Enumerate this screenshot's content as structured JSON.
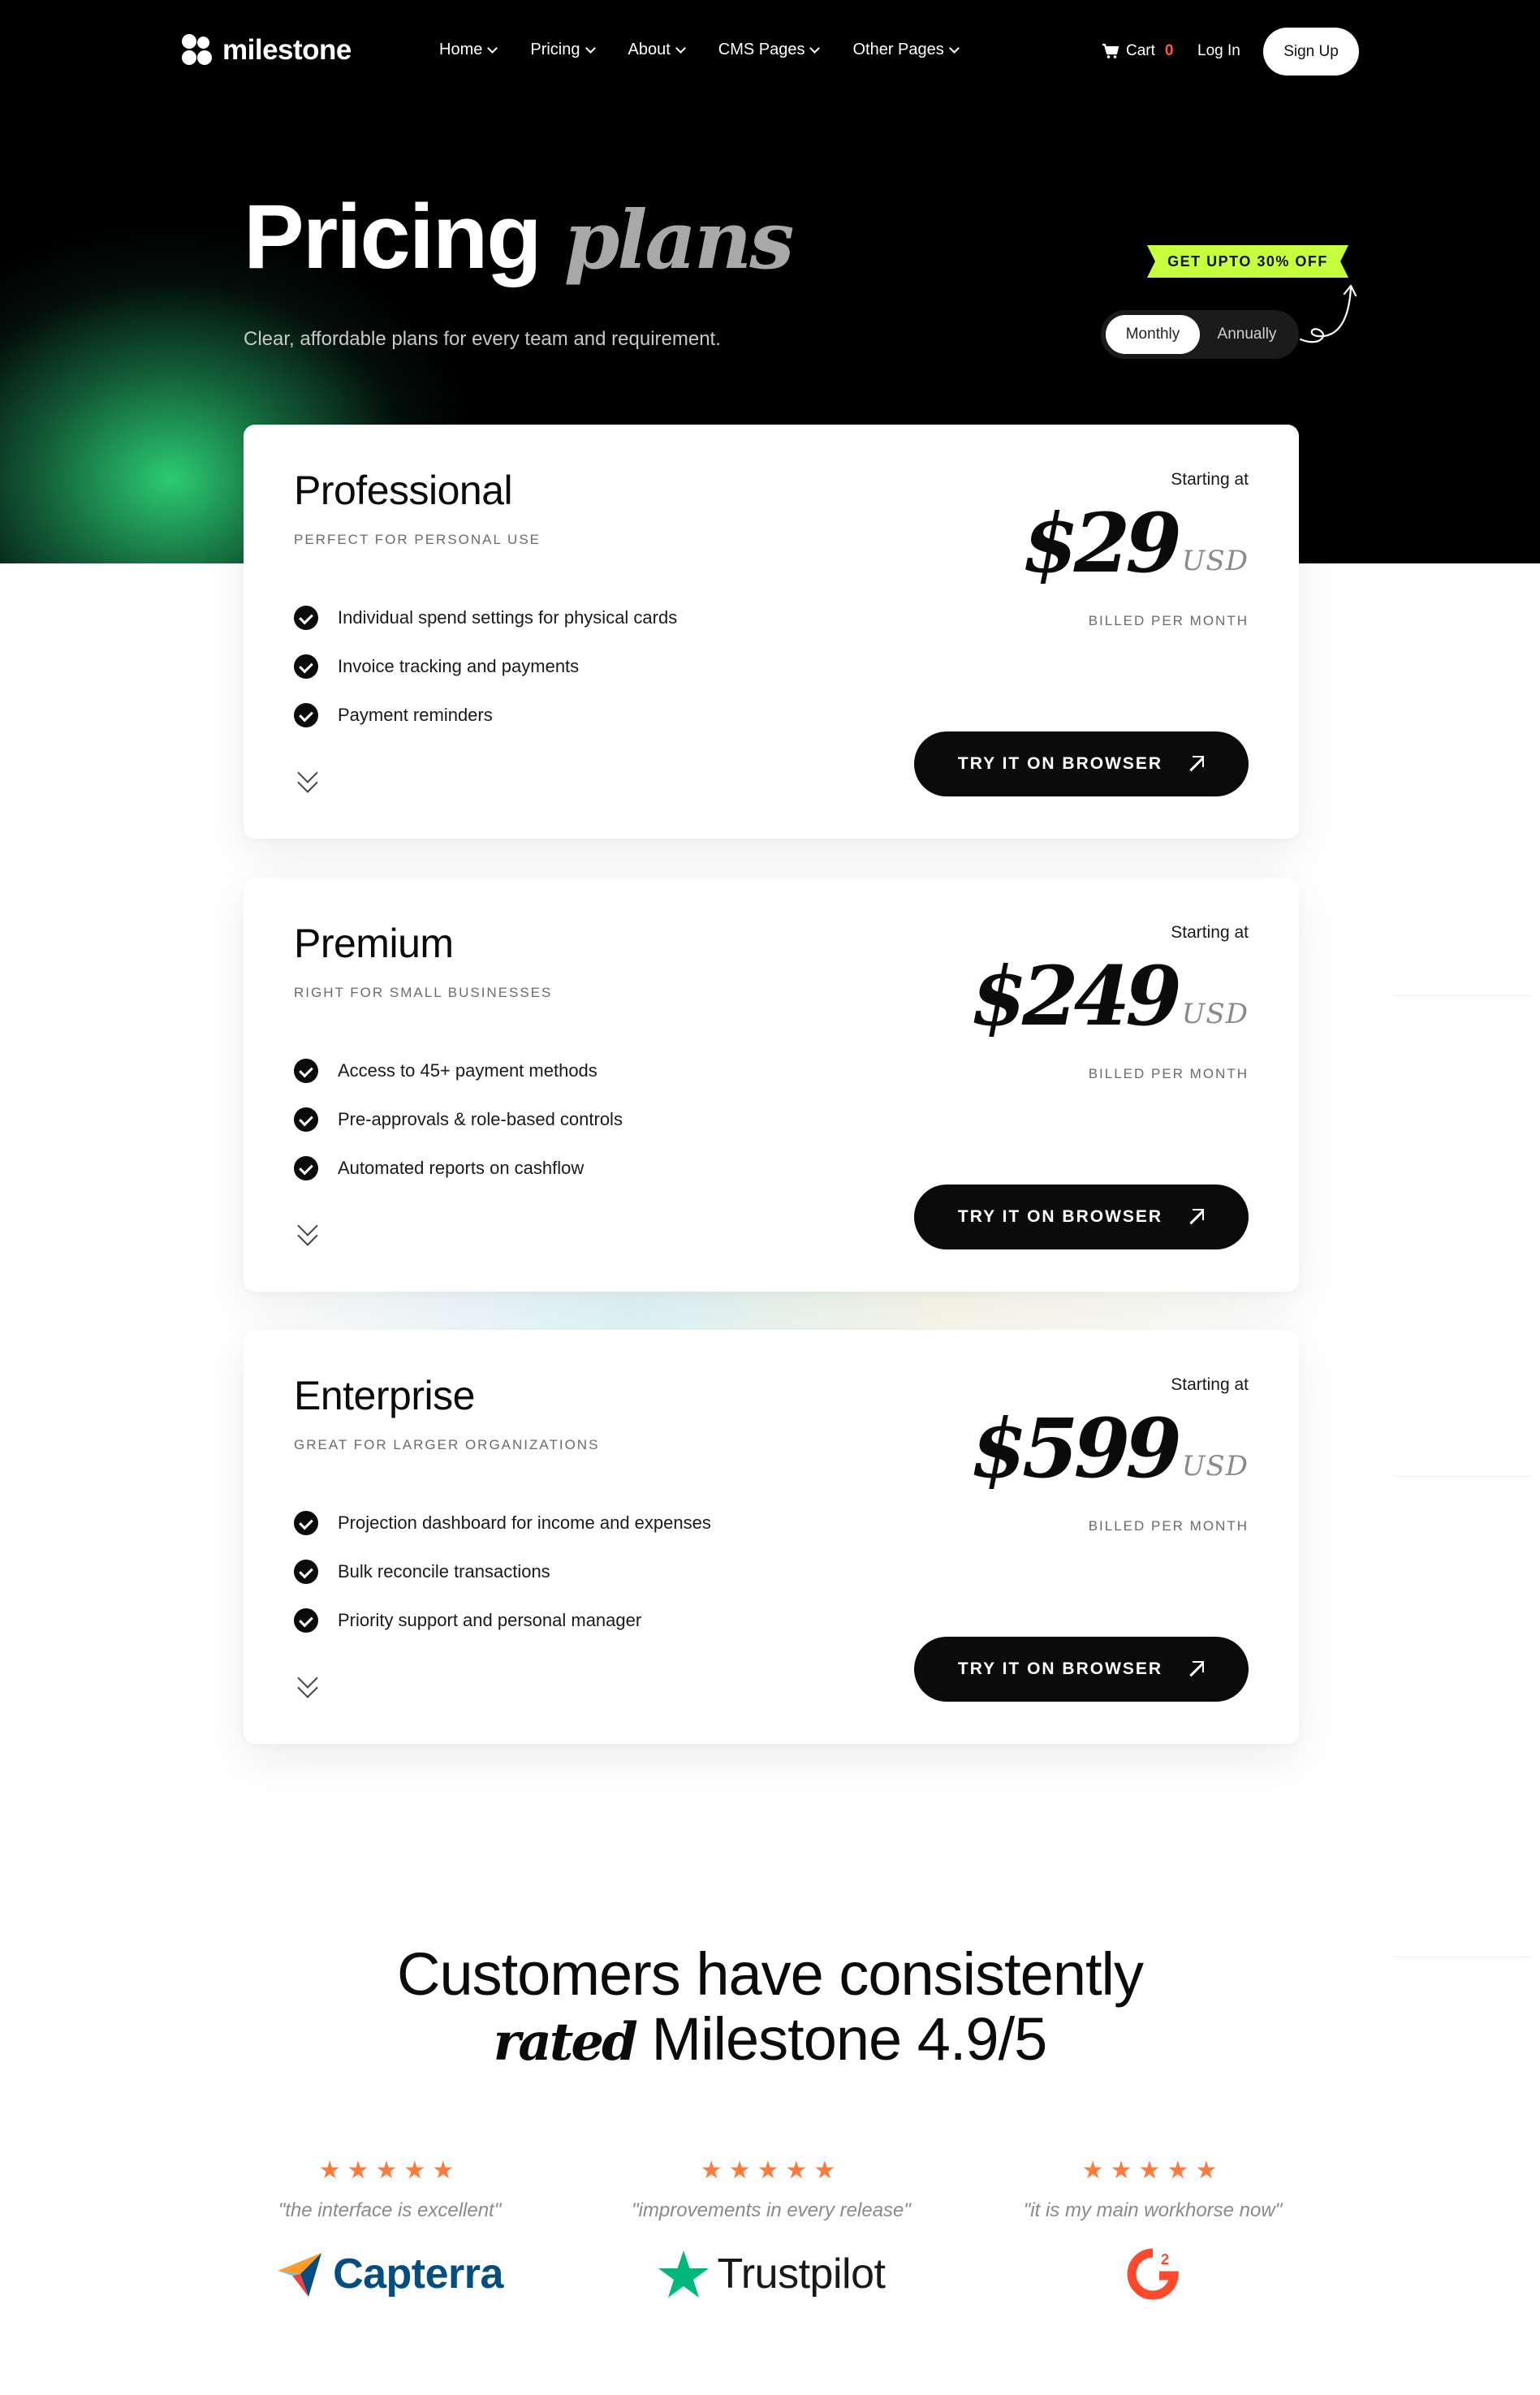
{
  "nav": {
    "brand": "milestone",
    "menu": [
      {
        "label": "Home"
      },
      {
        "label": "Pricing"
      },
      {
        "label": "About"
      },
      {
        "label": "CMS Pages"
      },
      {
        "label": "Other Pages"
      }
    ],
    "cart_label": "Cart",
    "cart_count": "0",
    "login": "Log In",
    "signup": "Sign Up"
  },
  "hero": {
    "title_main": "Pricing",
    "title_italic": "plans",
    "subtitle": "Clear, affordable plans for every team and requirement.",
    "promo": "GET UPTO 30% OFF",
    "toggle": {
      "monthly": "Monthly",
      "annually": "Annually",
      "selected": "Monthly"
    }
  },
  "plans": [
    {
      "name": "Professional",
      "tagline": "PERFECT FOR PERSONAL USE",
      "features": [
        "Individual spend settings for physical cards",
        "Invoice tracking and payments",
        "Payment reminders"
      ],
      "starting": "Starting at",
      "price": "$29",
      "currency": "USD",
      "billed": "BILLED PER MONTH",
      "cta": "TRY IT ON BROWSER"
    },
    {
      "name": "Premium",
      "tagline": "RIGHT FOR SMALL BUSINESSES",
      "features": [
        "Access to 45+ payment methods",
        "Pre-approvals & role-based controls",
        "Automated reports on cashflow"
      ],
      "starting": "Starting at",
      "price": "$249",
      "currency": "USD",
      "billed": "BILLED PER MONTH",
      "cta": "TRY IT ON BROWSER"
    },
    {
      "name": "Enterprise",
      "tagline": "GREAT FOR LARGER ORGANIZATIONS",
      "features": [
        "Projection dashboard for income and expenses",
        "Bulk reconcile transactions",
        "Priority support and personal manager"
      ],
      "starting": "Starting at",
      "price": "$599",
      "currency": "USD",
      "billed": "BILLED PER MONTH",
      "cta": "TRY IT ON BROWSER"
    }
  ],
  "ratings": {
    "line1": "Customers have consistently",
    "line2_italic": "rated",
    "line2_rest": "Milestone 4.9/5",
    "reviews": [
      {
        "stars": "★★★★★",
        "rating": 5,
        "quote": "\"the interface is excellent\"",
        "brand": "Capterra"
      },
      {
        "stars": "★★★★★",
        "rating": 5,
        "quote": "\"improvements in every release\"",
        "brand": "Trustpilot"
      },
      {
        "stars": "★★★★★",
        "rating": 5,
        "quote": "\"it is my main workhorse now\"",
        "brand": "G2"
      }
    ]
  },
  "colors": {
    "accent_promo": "#c6ff3d",
    "star": "#ff7a3d",
    "cart_count": "#ff5a3c",
    "trustpilot": "#00b67a",
    "g2": "#ff492c",
    "capterra_blue": "#044d80"
  }
}
